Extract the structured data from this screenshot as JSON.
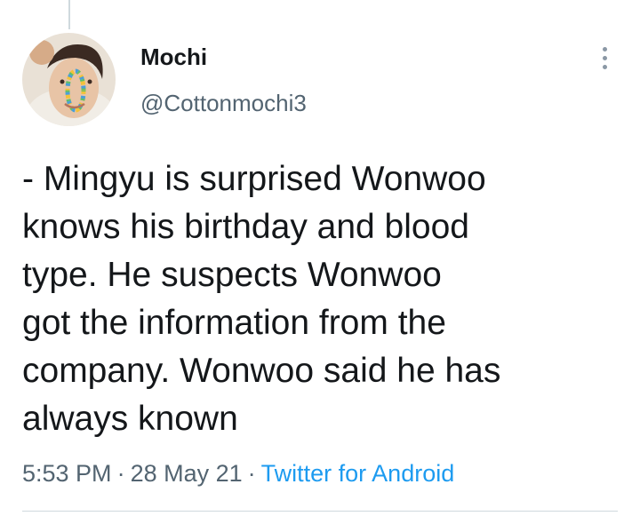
{
  "author": {
    "display_name": "Mochi",
    "handle": "@Cottonmochi3",
    "avatar": "profile-photo"
  },
  "tweet": {
    "text_lines": [
      "- Mingyu is surprised Wonwoo",
      "knows his birthday and blood",
      "type. He suspects Wonwoo",
      "got the information from the",
      "company. Wonwoo said he has",
      "always known"
    ],
    "time": "5:53 PM",
    "date": "28 May 21",
    "separator": "·",
    "source": "Twitter for Android"
  },
  "icons": {
    "more": "more-vertical-icon"
  },
  "colors": {
    "text": "#14171a",
    "secondary": "#536471",
    "link": "#1d9bf0",
    "divider": "#cfd9de"
  }
}
